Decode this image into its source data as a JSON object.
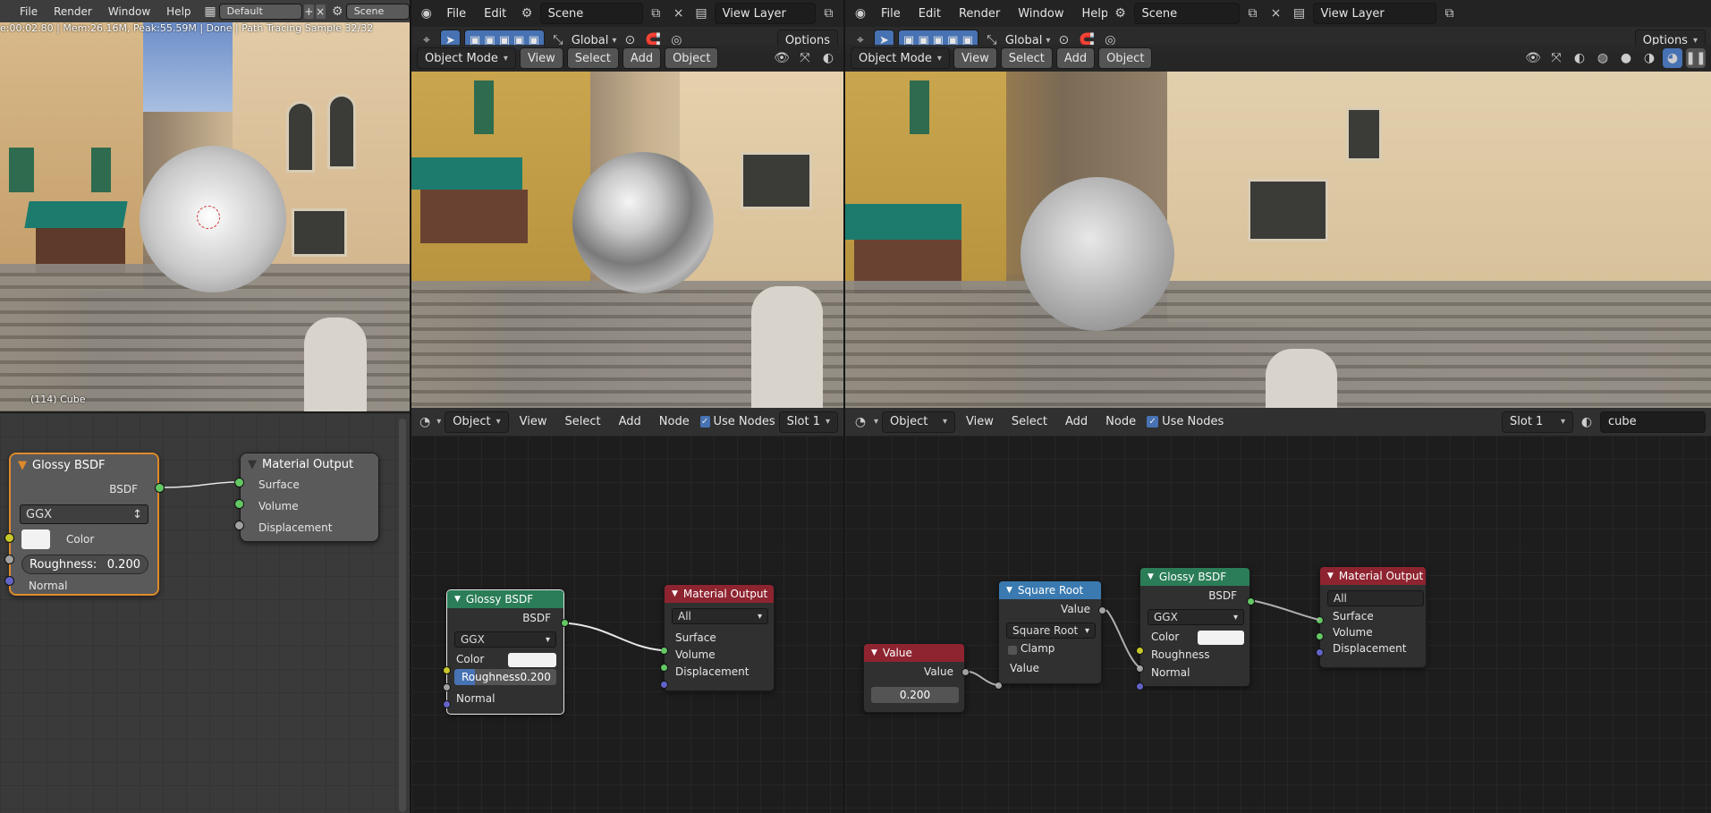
{
  "left": {
    "menus": [
      "File",
      "Render",
      "Window",
      "Help"
    ],
    "layout": "Default",
    "scene": "Scene",
    "status": "e:00:02.80 | Mem:26.16M, Peak:55.59M | Done | Path Tracing Sample 32/32",
    "object_label": "(114) Cube",
    "node_glossy": {
      "title": "Glossy BSDF",
      "output": "BSDF",
      "distribution": "GGX",
      "color": "Color",
      "roughness_label": "Roughness:",
      "roughness_value": "0.200",
      "normal": "Normal"
    },
    "node_output": {
      "title": "Material Output",
      "surface": "Surface",
      "volume": "Volume",
      "displacement": "Displacement"
    }
  },
  "middle": {
    "menus": [
      "File",
      "Edit"
    ],
    "scene": "Scene",
    "view_layer": "View Layer",
    "transform": "Global",
    "options": "Options",
    "mode": "Object Mode",
    "vp_menus": [
      "View",
      "Select",
      "Add",
      "Object"
    ],
    "editor": {
      "type": "Object",
      "menus": [
        "View",
        "Select",
        "Add",
        "Node"
      ],
      "use_nodes": "Use Nodes",
      "slot": "Slot 1"
    },
    "node_glossy": {
      "title": "Glossy BSDF",
      "output": "BSDF",
      "distribution": "GGX",
      "color": "Color",
      "roughness_label": "Roughness",
      "roughness_value": "0.200",
      "normal": "Normal"
    },
    "node_output": {
      "title": "Material Output",
      "target": "All",
      "surface": "Surface",
      "volume": "Volume",
      "displacement": "Displacement"
    }
  },
  "right": {
    "menus": [
      "File",
      "Edit",
      "Render",
      "Window",
      "Help"
    ],
    "scene": "Scene",
    "view_layer": "View Layer",
    "transform": "Global",
    "options": "Options",
    "mode": "Object Mode",
    "vp_menus": [
      "View",
      "Select",
      "Add",
      "Object"
    ],
    "editor": {
      "type": "Object",
      "menus": [
        "View",
        "Select",
        "Add",
        "Node"
      ],
      "use_nodes": "Use Nodes",
      "slot": "Slot 1",
      "material": "cube"
    },
    "node_value": {
      "title": "Value",
      "output": "Value",
      "value": "0.200"
    },
    "node_sqrt": {
      "title": "Square Root",
      "output": "Value",
      "operation": "Square Root",
      "clamp": "Clamp",
      "input": "Value"
    },
    "node_glossy": {
      "title": "Glossy BSDF",
      "output": "BSDF",
      "distribution": "GGX",
      "color": "Color",
      "roughness": "Roughness",
      "normal": "Normal"
    },
    "node_output": {
      "title": "Material Output",
      "target": "All",
      "surface": "Surface",
      "volume": "Volume",
      "displacement": "Displacement"
    }
  },
  "colors": {
    "header_bg": "#303030",
    "node_green": "#2a7d57",
    "node_red": "#8e2430",
    "node_blue": "#3a7ab0",
    "node_selected_border": "#e08a2b",
    "accent_blue": "#4772b3"
  },
  "icons": [
    "blender-logo-icon",
    "select-cursor-icon",
    "transform-pivot-icon",
    "snap-icon",
    "eye-icon",
    "gizmo-icon",
    "overlay-icon",
    "shading-wire-icon",
    "shading-solid-icon",
    "shading-material-icon",
    "shading-render-icon",
    "pause-icon",
    "chevron-down-icon",
    "checkbox-icon"
  ]
}
